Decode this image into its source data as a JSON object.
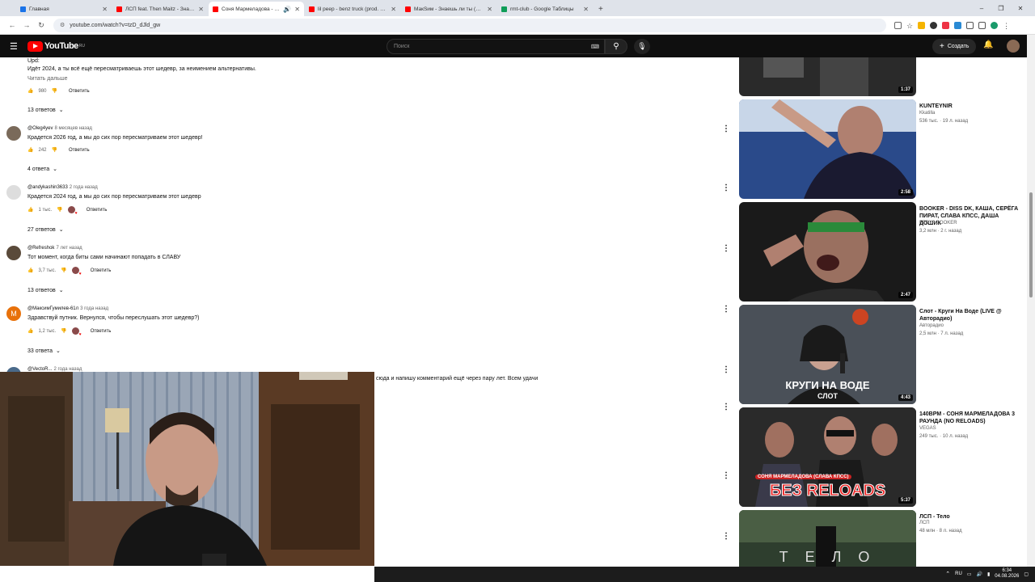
{
  "browser": {
    "tabs": [
      {
        "label": "Главная",
        "color": "#1a73e8"
      },
      {
        "label": "ЛСП feat. Then Maitz - Знаешь...",
        "color": "#f00"
      },
      {
        "label": "Соня Мармеладова - BAUS...",
        "color": "#f00"
      },
      {
        "label": "lil peep - benz truck (prod. sm...",
        "color": "#f00"
      },
      {
        "label": "МакSим - Знаешь ли ты (Мат...",
        "color": "#f00"
      },
      {
        "label": "rmt-club - Google Таблицы",
        "color": "#0f9d58"
      }
    ],
    "url": "youtube.com/watch?v=tzD_dJld_gw",
    "window_controls": [
      "–",
      "❐",
      "✕"
    ],
    "new_tab": "+"
  },
  "youtube": {
    "logo": "YouTube",
    "region": "RU",
    "search_placeholder": "Поиск",
    "create_label": "Создать"
  },
  "comments": [
    {
      "top_text_1": "Upd:",
      "text": "Идёт 2024, а ты всё ещё пересматриваешь этот шедевр, за неимением альтернативы.",
      "read_more": "Читать дальше",
      "likes": "980",
      "reply": "Ответить",
      "replies": "13 ответов"
    },
    {
      "author": "@Oleg4yev",
      "age": "8 месяцев назад",
      "text": "Крадется 2026 год, а мы до сих пор пересматриваем этот шедевр!",
      "likes": "242",
      "reply": "Ответить",
      "replies": "4 ответа"
    },
    {
      "author": "@andykashin3633",
      "age": "2 года назад",
      "text": "Крадется 2024 год, а мы до сих пор пересматриваем этот шедевр",
      "likes": "1 тыс.",
      "reply": "Ответить",
      "replies": "27 ответов"
    },
    {
      "author": "@Refreshok",
      "age": "7 лет назад",
      "text": "Тот момент, когда биты сами начинают попадать в СЛАВУ",
      "likes": "3,7 тыс.",
      "reply": "Ответить",
      "replies": "13 ответов"
    },
    {
      "author": "@МаксимГумилев-61л",
      "age": "3 года назад",
      "avatar_letter": "М",
      "text": "Здравствуй путник. Вернулся, чтобы переслушать этот шедевр?)",
      "likes": "1,2 тыс.",
      "reply": "Ответить",
      "replies": "33 ответа"
    },
    {
      "author": "@VectoR...",
      "age": "2 года назад",
      "text": "сюда и напишу комментарий ещё через пару лет. Всем удачи"
    }
  ],
  "related": [
    {
      "duration": "1:37",
      "title": "",
      "channel": "",
      "meta": ""
    },
    {
      "duration": "2:58",
      "title": "KUNTEYNIR",
      "channel": "Kkatilla",
      "meta": "536 тыс.  ·  19 л. назад"
    },
    {
      "duration": "2:47",
      "title": "BOOKER - DISS DK, КАША, СЕРЁГА ПИРАТ, СЛАВА КПСС, ДАША ДОШИК",
      "channel": "FEDYA BOOKER",
      "meta": "3,2 млн  ·  2 г. назад"
    },
    {
      "duration": "4:43",
      "title": "Слот - Круги На Воде (LIVE @ Авторадио)",
      "channel": "Авторадио",
      "meta": "2,5 млн  ·  7 л. назад",
      "thumb_text_1": "КРУГИ НА ВОДЕ",
      "thumb_text_2": "СЛОТ"
    },
    {
      "duration": "5:37",
      "title": "140BPM - СОНЯ МАРМЕЛАДОВА 3 РАУНДА (NO RELOADS)",
      "channel": "VEGAS",
      "meta": "249 тыс.  ·  10 л. назад",
      "thumb_text_1": "СОНЯ МАРМЕЛАДОВА (СЛАВА КПСС)",
      "thumb_text_2": "БЕЗ RELOADS"
    },
    {
      "duration": "",
      "title": "ЛСП - Тело",
      "channel": "ЛСП",
      "meta": "48 млн  ·  8 л. назад",
      "thumb_text_1": "Т  Е  Л  О"
    }
  ],
  "taskbar": {
    "lang": "RU",
    "time": "6:34",
    "date": "04.08.2026"
  }
}
